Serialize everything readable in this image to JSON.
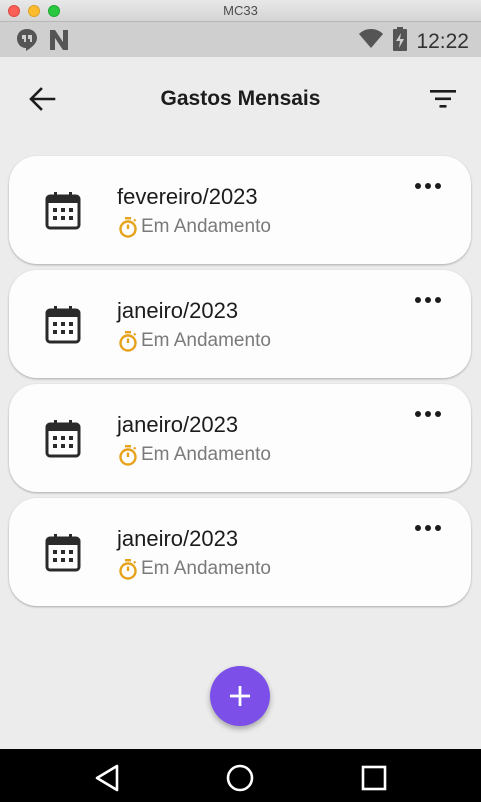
{
  "window": {
    "title": "MC33"
  },
  "status_bar": {
    "time": "12:22",
    "icons": [
      "hangouts-icon",
      "n-icon",
      "wifi-icon",
      "battery-charging-icon"
    ]
  },
  "app_bar": {
    "title": "Gastos Mensais",
    "back_icon": "arrow-back-icon",
    "filter_icon": "filter-icon"
  },
  "cards": [
    {
      "month": "fevereiro/2023",
      "status": "Em Andamento"
    },
    {
      "month": "janeiro/2023",
      "status": "Em Andamento"
    },
    {
      "month": "janeiro/2023",
      "status": "Em Andamento"
    },
    {
      "month": "janeiro/2023",
      "status": "Em Andamento"
    }
  ],
  "fab": {
    "icon": "plus-icon"
  },
  "nav_bar": {
    "icons": [
      "back-triangle-icon",
      "home-circle-icon",
      "recents-square-icon"
    ]
  },
  "colors": {
    "accent": "#7b4fe8",
    "status_icon": "#e6a21a",
    "background": "#ececec",
    "card": "#fdfdfd"
  }
}
